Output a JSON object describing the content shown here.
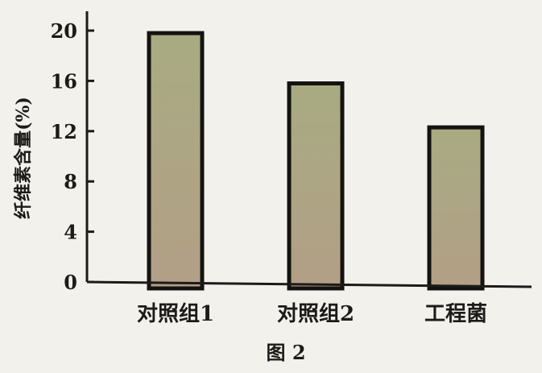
{
  "chart_data": {
    "type": "bar",
    "categories": [
      "对照组1",
      "对照组2",
      "工程菌"
    ],
    "values": [
      19.8,
      15.8,
      12.3
    ],
    "ylabel": "纤维素含量(%)",
    "xlabel": "",
    "ylim": [
      0,
      20
    ],
    "yticks": [
      0,
      4,
      8,
      12,
      16,
      20
    ],
    "caption": "图 2",
    "grid": false,
    "colors": {
      "axis": "#1c1b19",
      "bar_outline": "#141311",
      "bar_top": "#a8ab82",
      "bar_bottom": "#b29f86"
    }
  }
}
